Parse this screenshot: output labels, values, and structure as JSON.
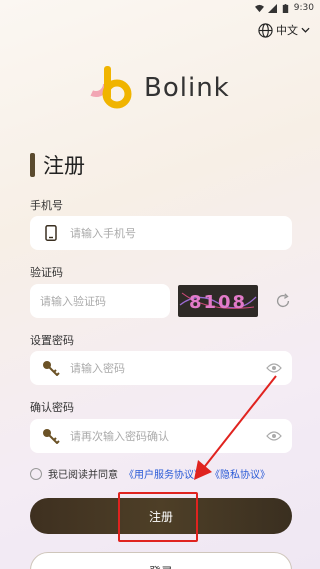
{
  "status_bar": {
    "time": "9:30"
  },
  "language": {
    "label": "中文"
  },
  "brand": {
    "name": "Bolink"
  },
  "page": {
    "title": "注册"
  },
  "phone": {
    "label": "手机号",
    "placeholder": "请输入手机号"
  },
  "captcha": {
    "label": "验证码",
    "placeholder": "请输入验证码",
    "image_text": "8108"
  },
  "password": {
    "label": "设置密码",
    "placeholder": "请输入密码"
  },
  "confirm_password": {
    "label": "确认密码",
    "placeholder": "请再次输入密码确认"
  },
  "agreement": {
    "prefix": "我已阅读并同意",
    "service_link": "《用户服务协议》",
    "privacy_link": "《隐私协议》"
  },
  "buttons": {
    "register": "注册",
    "login": "登录"
  },
  "colors": {
    "accent_dark": "#4a3b25",
    "link": "#2a5bd7",
    "annotation": "#e0231f"
  }
}
